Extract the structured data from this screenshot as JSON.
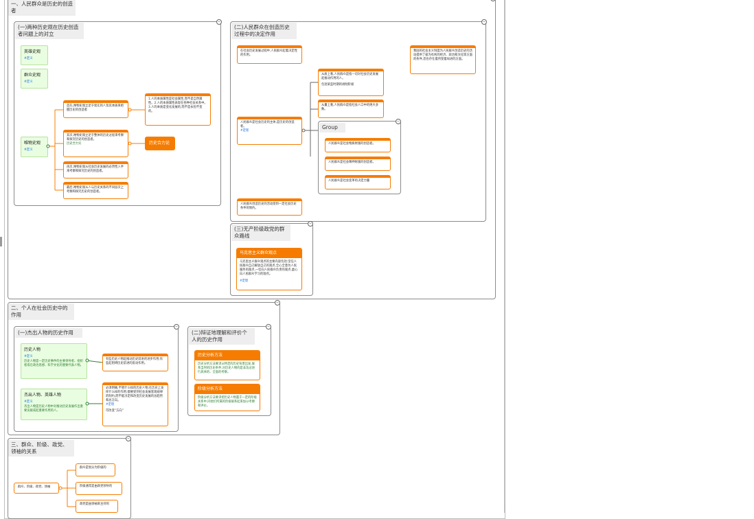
{
  "section1": {
    "title": "一、人民群众是历史的创造者",
    "sub1": {
      "title": "(一)两种历史观在历史创造者问题上的对立",
      "heroic": {
        "label": "英雄史观",
        "tag": "#定义"
      },
      "masses": {
        "label": "群众史观",
        "tag": "#定义"
      },
      "materialist": {
        "label": "唯物史观",
        "tag": "#定义"
      },
      "points": [
        "首先,唯物史观立足于现实的人及其本质来把握历史的创造者",
        "其次,唯物史观立足于整体的历史过程来考察和探究历史的创造者。",
        "再次,唯物史观从社会历史发展的必然性入手来考察和探究历史的创造者。",
        "最后,唯物史观从人与历史关系的不同层次上考察和探究历史的创造者。"
      ],
      "points_extra": "历史合力论",
      "essence_note": "1.人的本质属性是社会属性,而不是自然属性。2.人的本质属性表现在各种社会关系中。3.人的本质是变化发展的,而不是永恒不变的。",
      "theory_label": "历史合力论"
    },
    "sub2": {
      "title": "(二)人民群众在创造历史过程中的决定作用",
      "note_top": "在社会历史发展过程中,人民群众起着决定性的作用。",
      "note_right": "我国的社会主义制度为人民群众创造历史的活动提供了极为有利的经济、政治和文化等方面的条件,您也存在着所受着局进的方面。",
      "main": {
        "text": "人民群众是社会历史的主体,是历史的创造者。",
        "tag": "#定理"
      },
      "quality_note": "从质上看,人民群众是指一切对社会历史发展起推动作用的人。",
      "quality_extra": "包括某些时期的剥削阶级",
      "quantity_note": "从量上看,人民群众是指社会人口中的绝大多数。",
      "group_label": "Group",
      "group_items": [
        "人民群众是社会物质财富的创造者。",
        "人民群众是社会精神财富的创造者。",
        "人民群众是社会变革的决定力量"
      ],
      "limit_note": "人民群众创造历史的活动受到一定社会历史条件的制约。"
    },
    "sub3": {
      "title": "(三)无产阶级政党的群众路线",
      "card_title": "马克思主义群众观点",
      "card_body": "马克思主义群众观点的主要内容包括:坚信人民群众自己解放自己的观点,全心全意为人民服务的观点,一切向人民群众负责的观点,虚心向人民群众学习的观点。",
      "card_tag": "#定理"
    }
  },
  "section2": {
    "title": "二、个人在社会历史中的作用",
    "sub1": {
      "title": "(一)杰出人物的历史作用",
      "hist_person": {
        "label": "历史人物",
        "tag": "#定义",
        "desc": "历史人物是一定历史事件的主要领导者、组织者或在政治思想、科学文化的重要代表人物。"
      },
      "outstanding": {
        "label": "杰出人物、英雄人物",
        "tag": "#定义",
        "desc": "杰出人物是历史人物中对推动历史发展作出重要贡献或起重要作用的人。"
      },
      "role_note": "有些历史人物起推动历史前进的进步作用;有些起阻碍历史前进的反动作用。",
      "necessity_note": "必须明确,不管什么样的历史人物,在历史上发挥什么样的作用,都要受到社会发展客观规律的制约,而不能决定和改变历史发展的总趋势和总方向。",
      "necessity_tag": "#定理",
      "necessity_extra": "可改变“方向”"
    },
    "sub2": {
      "title": "(二)辩证地理解和评价个人的历史作用",
      "hist_method": {
        "label": "历史分析方法",
        "body": "历史分析方法要求从特定的历史背景出发,联系当时的历史条件,对历史人物的是非功过进行具体的、全面的考察。"
      },
      "class_method": {
        "label": "阶级分析方法",
        "body": "阶级分析方法要求把历史人物置于一定的阶级关系中,同他们所属的阶级联系起来加以考察和评价。"
      }
    }
  },
  "section3": {
    "title": "三、群众、阶级、政党、领袖的关系",
    "root": "群众、阶级、政党、领袖",
    "children": [
      "群众是划分为阶级的",
      "阶级通常是由政党领导的",
      "政党是由领袖来主持的"
    ]
  }
}
